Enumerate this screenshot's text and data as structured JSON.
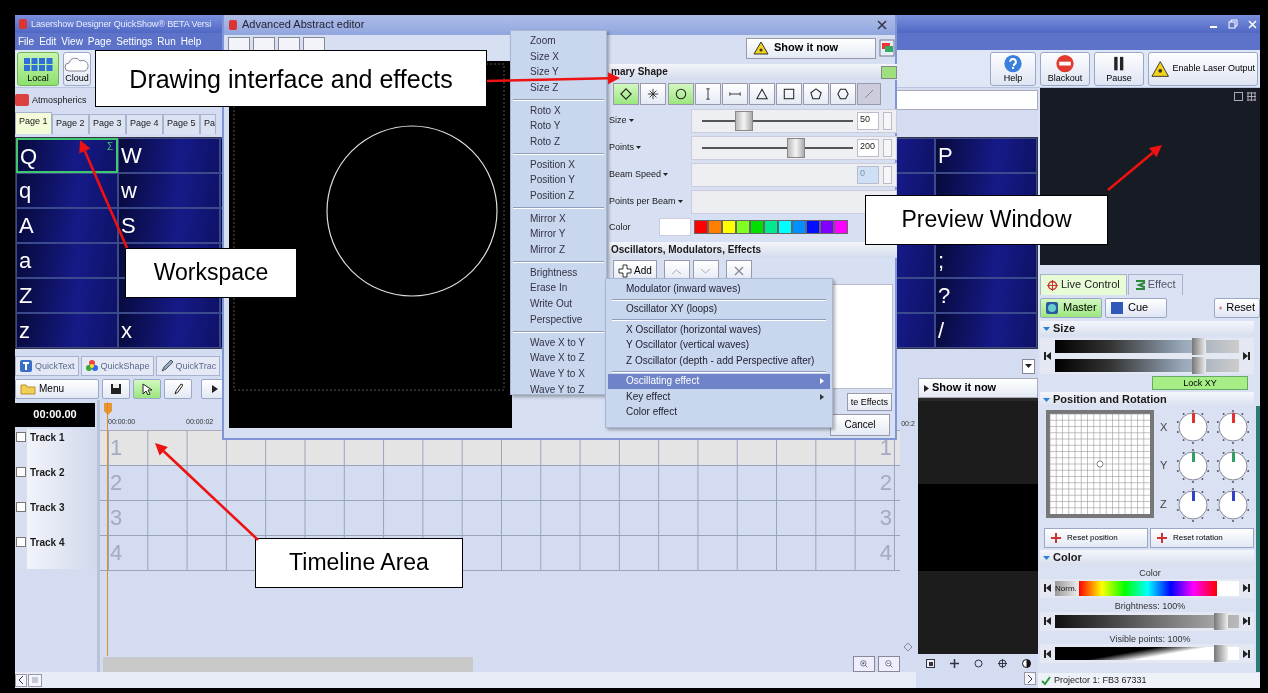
{
  "app": {
    "title": "Lasershow Designer QuickShow® BETA  Versi",
    "menu": [
      "File",
      "Edit",
      "View",
      "Page",
      "Settings",
      "Run",
      "Help"
    ],
    "storage": [
      {
        "label": "Local",
        "selected": true
      },
      {
        "label": "Cloud",
        "selected": false
      }
    ],
    "toolbar": [
      {
        "kind": "help",
        "label": "Help"
      },
      {
        "kind": "blackout",
        "label": "Blackout"
      },
      {
        "kind": "pause",
        "label": "Pause"
      },
      {
        "kind": "laser",
        "label": "Enable Laser Output"
      }
    ]
  },
  "category": {
    "label": "Atmospherics"
  },
  "page_tabs": [
    {
      "label": "Page 1",
      "selected": true
    },
    {
      "label": "Page 2",
      "selected": false
    },
    {
      "label": "Page 3",
      "selected": false
    },
    {
      "label": "Page 4",
      "selected": false
    },
    {
      "label": "Page 5",
      "selected": false
    },
    {
      "label": "Pa",
      "selected": false
    }
  ],
  "cues": {
    "rows": [
      {
        "cells": [
          {
            "label": "Q",
            "mark": "Σ",
            "selected": true
          },
          {
            "label": "W",
            "selected": false
          }
        ],
        "end": {
          "label": "P",
          "selected": false
        }
      },
      {
        "cells": [
          {
            "label": "q",
            "selected": false
          },
          {
            "label": "w",
            "selected": false
          }
        ]
      },
      {
        "cells": [
          {
            "label": "A",
            "selected": false
          },
          {
            "label": "S",
            "selected": false
          }
        ]
      },
      {
        "cells": [
          {
            "label": "a",
            "selected": false
          }
        ],
        "end": {
          "label": ";",
          "selected": false
        }
      },
      {
        "cells": [
          {
            "label": "Z",
            "selected": false
          }
        ],
        "end": {
          "label": "?",
          "selected": false
        }
      },
      {
        "cells": [
          {
            "label": "z",
            "selected": false
          },
          {
            "label": "x",
            "selected": false
          }
        ],
        "end": {
          "label": "/",
          "selected": false
        }
      }
    ]
  },
  "bottom_tabs": [
    {
      "kind": "text",
      "label": "QuickText"
    },
    {
      "kind": "shape",
      "label": "QuickShape"
    },
    {
      "kind": "trace",
      "label": "QuickTrac"
    }
  ],
  "timeline": {
    "menu_label": "Menu",
    "time": "00:00.00",
    "ruler": [
      "00:00:00",
      "00:00:02"
    ],
    "ruler_end": "00:2",
    "tracks": [
      {
        "label": "Track 1",
        "number": "1",
        "end_number": "1",
        "checked": false
      },
      {
        "label": "Track 2",
        "number": "2",
        "end_number": "2",
        "checked": false
      },
      {
        "label": "Track 3",
        "number": "3",
        "end_number": "3",
        "checked": false
      },
      {
        "label": "Track 4",
        "number": "4",
        "end_number": "4",
        "checked": false
      }
    ]
  },
  "mini_preview": {
    "button": "Show it now"
  },
  "live_panel": {
    "tabs": [
      {
        "label": "Live Control",
        "selected": true
      },
      {
        "label": "Effect",
        "selected": false
      }
    ],
    "modes": [
      {
        "label": "Master",
        "selected": true
      },
      {
        "label": "Cue",
        "selected": false
      }
    ],
    "reset": "Reset",
    "size": {
      "title": "Size",
      "lock": "Lock XY",
      "sliders": [
        {
          "level": 0.78
        },
        {
          "level": 0.78
        }
      ]
    },
    "position": {
      "title": "Position and Rotation",
      "axes": [
        {
          "label": "X",
          "color": "#e03030"
        },
        {
          "label": "Y",
          "color": "#2ea060"
        },
        {
          "label": "Z",
          "color": "#3040c8"
        }
      ],
      "reset_position": "Reset position",
      "reset_rotation": "Reset rotation"
    },
    "color": {
      "title": "Color",
      "color_label": "Color",
      "norm": "Norm.",
      "brightness": {
        "label": "Brightness: 100%",
        "level": 0.9
      },
      "visible_points": {
        "label": "Visible points: 100%",
        "level": 0.9
      }
    }
  },
  "status": "Projector 1: FB3 67331",
  "editor": {
    "title": "Advanced Abstract editor",
    "show_now": "Show it now",
    "section": "mary Shape",
    "modes": [
      {
        "kind": "outline",
        "selected": true
      },
      {
        "kind": "dots",
        "selected": false
      }
    ],
    "shapes": [
      {
        "kind": "circle",
        "selected": true
      },
      {
        "kind": "vline",
        "selected": false
      },
      {
        "kind": "hline",
        "selected": false
      },
      {
        "kind": "triangle",
        "selected": false
      },
      {
        "kind": "square",
        "selected": false
      },
      {
        "kind": "pentagon",
        "selected": false
      },
      {
        "kind": "hexagon",
        "selected": false
      }
    ],
    "params": [
      {
        "kind": "slider",
        "label": "Size",
        "value": "50",
        "level": 0.28
      },
      {
        "kind": "slider",
        "label": "Points",
        "value": "200",
        "level": 0.62
      },
      {
        "kind": "disabled",
        "label": "Beam Speed",
        "value": "0"
      },
      {
        "kind": "empty",
        "label": "Points per Beam"
      }
    ],
    "color_label": "Color",
    "palette": [
      {
        "color": "#ff0000"
      },
      {
        "color": "#ff8000"
      },
      {
        "color": "#ffff00"
      },
      {
        "color": "#80ff20"
      },
      {
        "color": "#00e000"
      },
      {
        "color": "#00e890"
      },
      {
        "color": "#00ffff"
      },
      {
        "color": "#0090ff"
      },
      {
        "color": "#0010ff"
      },
      {
        "color": "#8000ff"
      },
      {
        "color": "#ff00ff"
      }
    ],
    "fx_title": "Oscillators, Modulators, Effects",
    "add": "Add",
    "effects_button": "te Effects",
    "cancel": "Cancel"
  },
  "transform_menu": {
    "groups": [
      [
        "Zoom",
        "Size X",
        "Size Y",
        "Size Z"
      ],
      [
        "Roto X",
        "Roto Y",
        "Roto Z"
      ],
      [
        "Position X",
        "Position Y",
        "Position Z"
      ],
      [
        "Mirror X",
        "Mirror Y",
        "Mirror Z"
      ],
      [
        "Brightness",
        "Erase In",
        "Write Out",
        "Perspective"
      ],
      [
        "Wave X to Y",
        "Wave X to Z",
        "Wave Y to X",
        "Wave Y to Z"
      ]
    ]
  },
  "add_menu": {
    "groups": [
      [
        {
          "label": "Modulator (inward waves)",
          "selected": false,
          "submenu": false
        }
      ],
      [
        {
          "label": "Oscillator XY (loops)",
          "selected": false,
          "submenu": false
        }
      ],
      [
        {
          "label": "X Oscillator (horizontal waves)",
          "selected": false,
          "submenu": false
        },
        {
          "label": "Y Oscillator (vertical waves)",
          "selected": false,
          "submenu": false
        },
        {
          "label": "Z Oscillator (depth - add Perspective after)",
          "selected": false,
          "submenu": false
        }
      ],
      [
        {
          "label": "Oscillating effect",
          "selected": true,
          "submenu": true
        },
        {
          "label": "Key effect",
          "selected": false,
          "submenu": true
        },
        {
          "label": "Color effect",
          "selected": false,
          "submenu": false
        }
      ]
    ]
  },
  "callouts": [
    {
      "label": "Drawing interface and effects"
    },
    {
      "label": "Workspace"
    },
    {
      "label": "Preview Window"
    },
    {
      "label": "Timeline Area"
    }
  ]
}
